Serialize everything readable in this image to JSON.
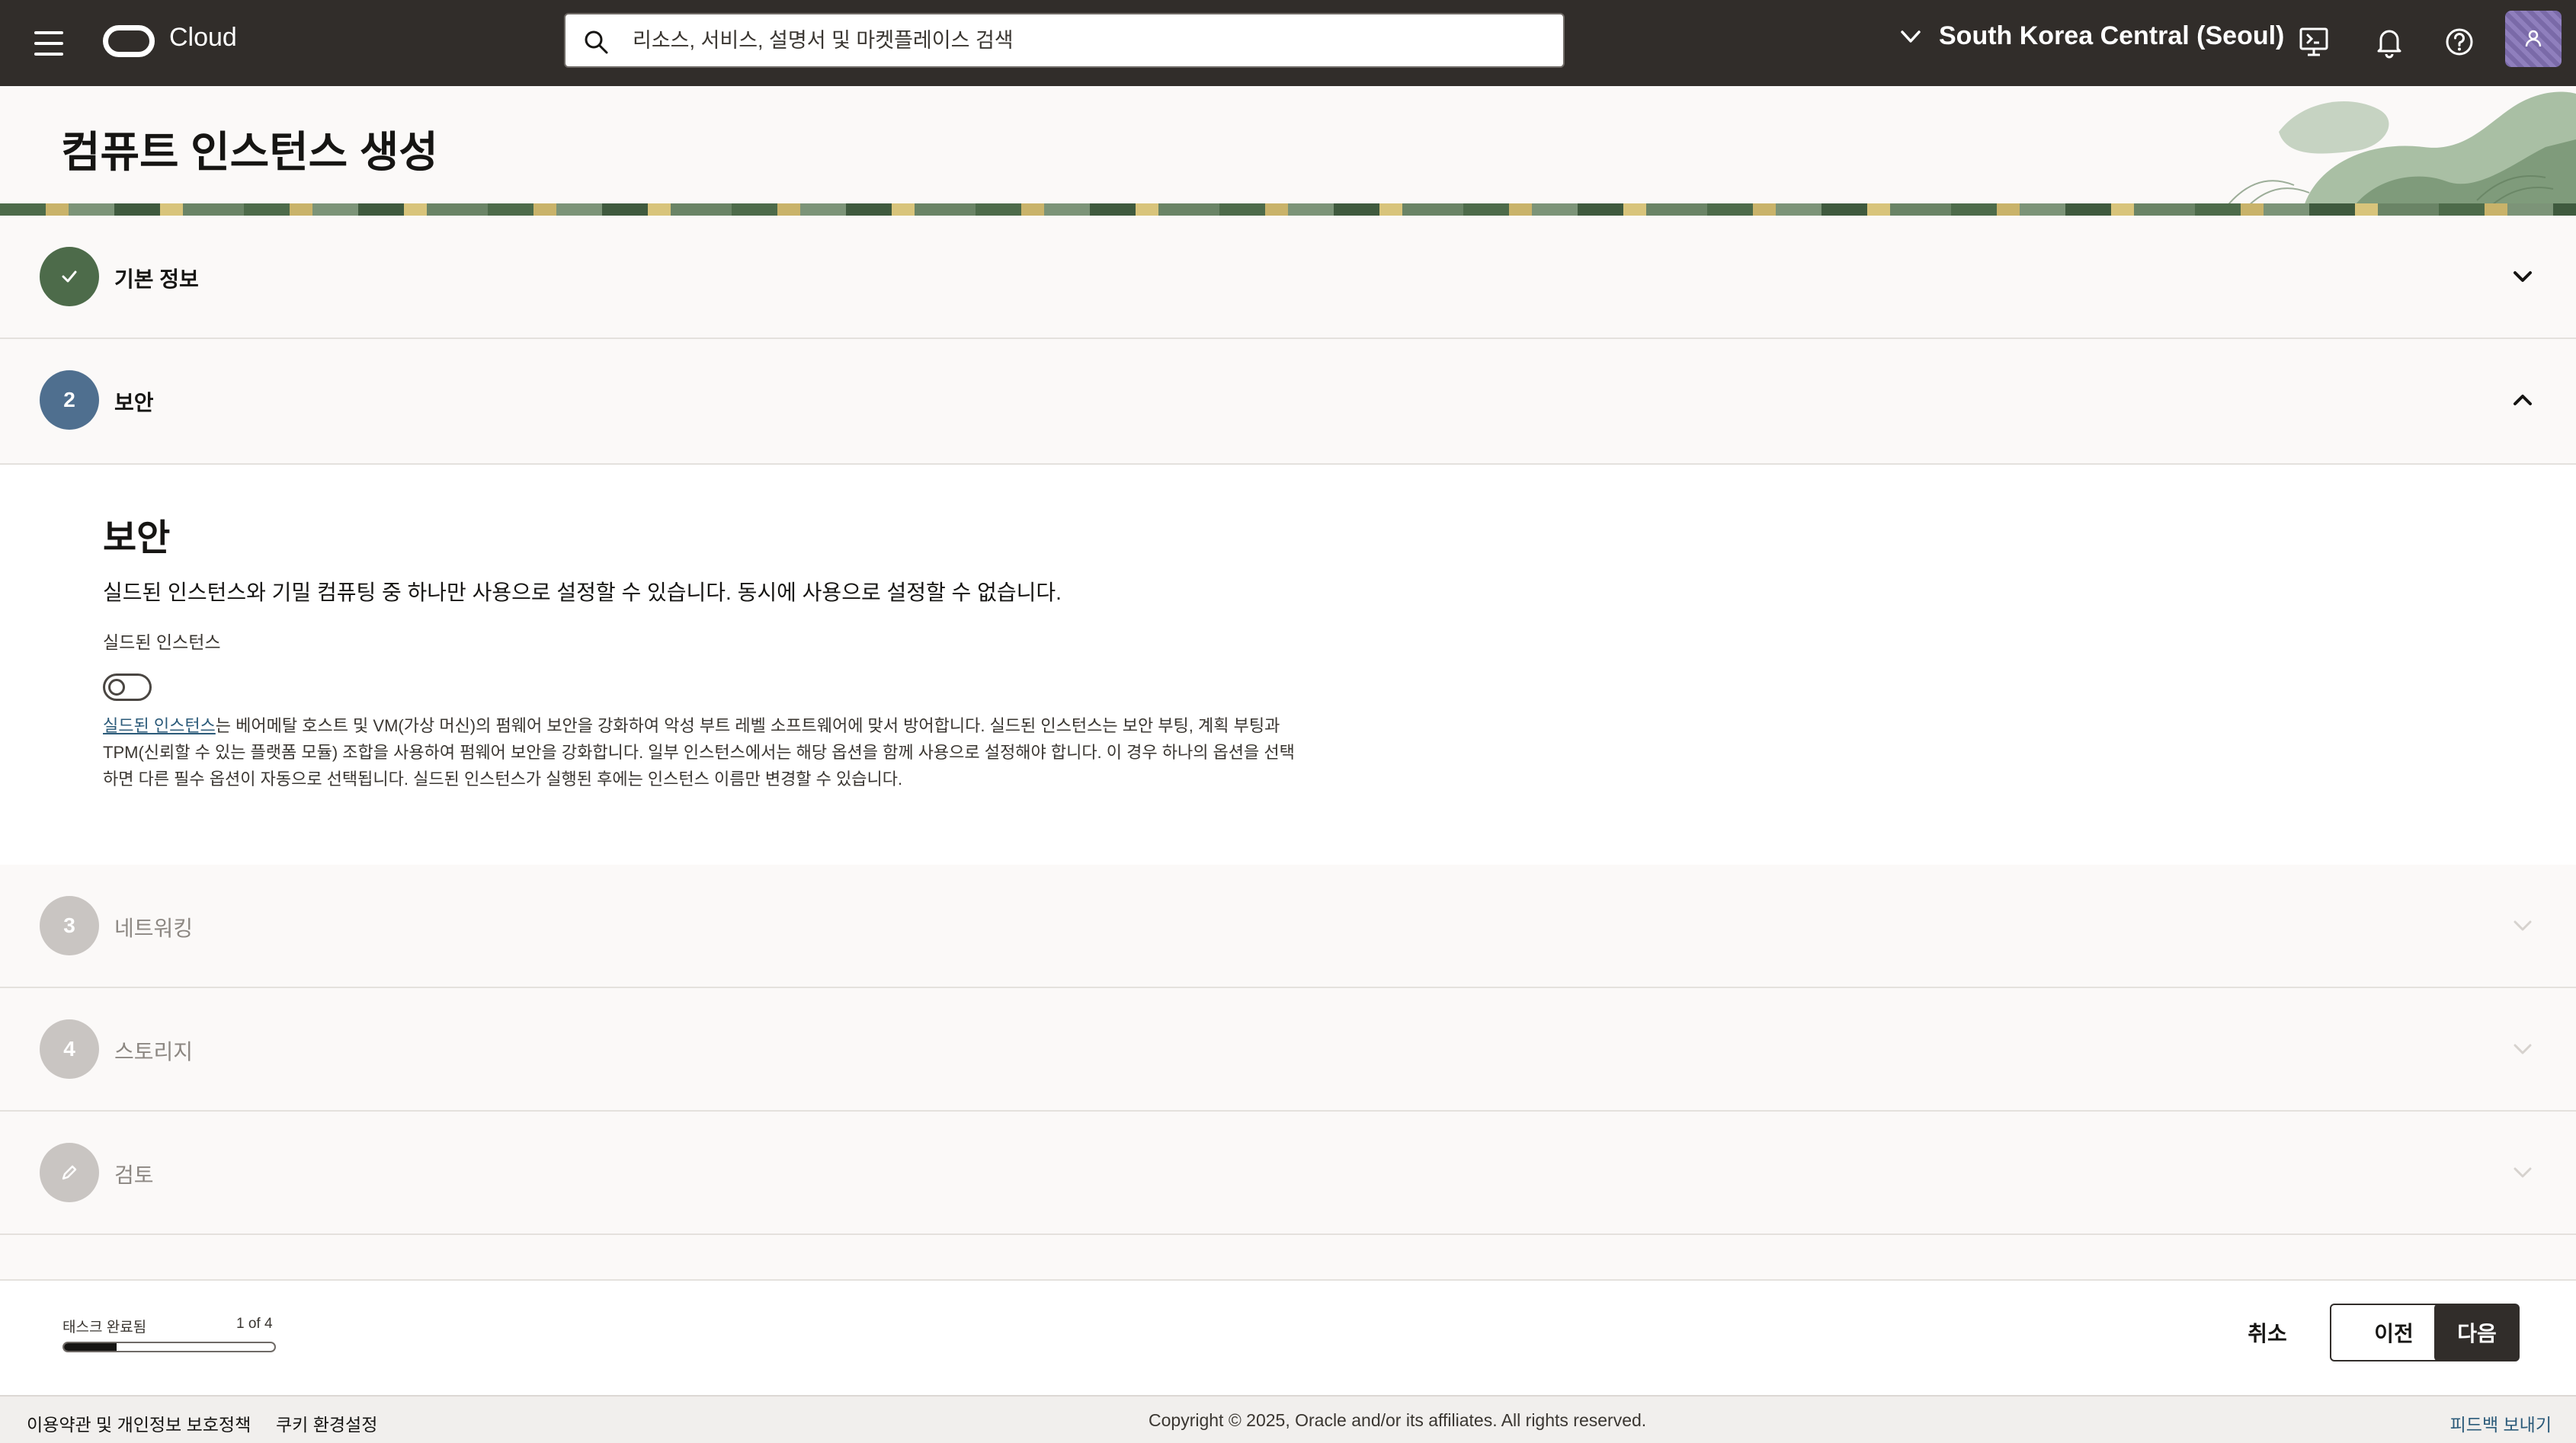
{
  "topbar": {
    "brand": "Cloud",
    "search_placeholder": "리소스, 서비스, 설명서 및 마켓플레이스 검색",
    "region": "South Korea Central (Seoul)"
  },
  "page": {
    "title": "컴퓨트 인스턴스 생성"
  },
  "steps": [
    {
      "number": "✓",
      "label": "기본 정보",
      "state": "completed"
    },
    {
      "number": "2",
      "label": "보안",
      "state": "active"
    },
    {
      "number": "3",
      "label": "네트워킹",
      "state": "disabled"
    },
    {
      "number": "4",
      "label": "스토리지",
      "state": "disabled"
    },
    {
      "number": "",
      "label": "검토",
      "state": "disabled"
    }
  ],
  "security": {
    "heading": "보안",
    "description": "실드된 인스턴스와 기밀 컴퓨팅 중 하나만 사용으로 설정할 수 있습니다. 동시에 사용으로 설정할 수 없습니다.",
    "field_label": "실드된 인스턴스",
    "toggle_on": false,
    "help_link": "실드된 인스턴스",
    "help_text_line1": "는 베어메탈 호스트 및 VM(가상 머신)의 펌웨어 보안을 강화하여 악성 부트 레벨 소프트웨어에 맞서 방어합니다. 실드된 인스턴스는 보안 부팅, 계획 부팅과",
    "help_text_line2": "TPM(신뢰할 수 있는 플랫폼 모듈) 조합을 사용하여 펌웨어 보안을 강화합니다. 일부 인스턴스에서는 해당 옵션을 함께 사용으로 설정해야 합니다. 이 경우 하나의 옵션을 선택",
    "help_text_line3": "하면 다른 필수 옵션이 자동으로 선택됩니다. 실드된 인스턴스가 실행된 후에는 인스턴스 이름만 변경할 수 있습니다."
  },
  "progress": {
    "label": "태스크 완료됨",
    "count": "1 of 4",
    "fraction": 0.25
  },
  "actions": {
    "cancel": "취소",
    "previous": "이전",
    "next": "다음"
  },
  "footer": {
    "terms": "이용약관 및 개인정보 보호정책",
    "cookies": "쿠키 환경설정",
    "copyright": "Copyright © 2025, Oracle and/or its affiliates. All rights reserved.",
    "feedback": "피드백 보내기"
  },
  "colors": {
    "navbar": "#312d2a",
    "step_completed": "#4d6b4a",
    "step_active": "#4f6f8f",
    "step_disabled": "#c9c5c2",
    "link": "#2c5b7a"
  },
  "icons": [
    "menu-icon",
    "oracle-logo-icon",
    "search-icon",
    "chevron-down-icon",
    "cloud-shell-icon",
    "bell-icon",
    "help-icon",
    "user-icon",
    "check-icon",
    "chevron-up-icon",
    "pencil-icon"
  ]
}
